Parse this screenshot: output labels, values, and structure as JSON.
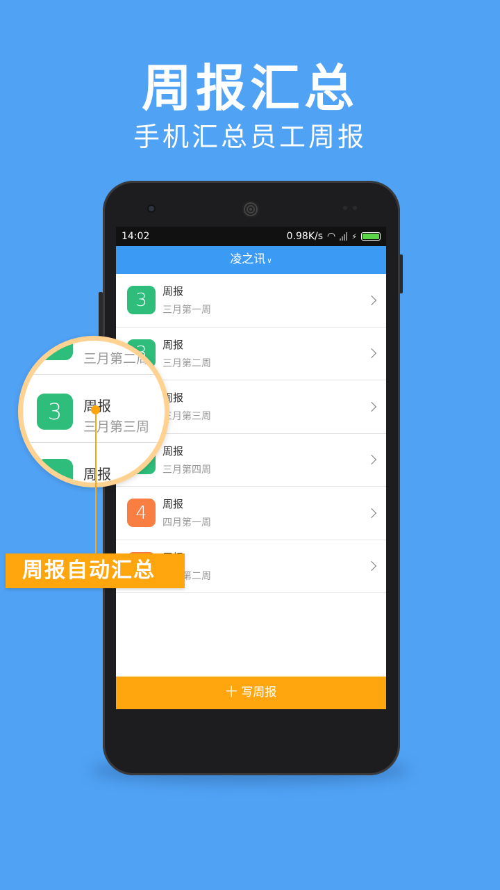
{
  "hero": {
    "title": "周报汇总",
    "subtitle": "手机汇总员工周报"
  },
  "status_bar": {
    "time": "14:02",
    "speed": "0.98K/s"
  },
  "app_bar": {
    "title": "凌之讯"
  },
  "reports": [
    {
      "badge": "3",
      "title": "周报",
      "subtitle": "三月第一周",
      "color": "#2ebd7a"
    },
    {
      "badge": "3",
      "title": "周报",
      "subtitle": "三月第二周",
      "color": "#2ebd7a"
    },
    {
      "badge": "3",
      "title": "周报",
      "subtitle": "三月第三周",
      "color": "#2ebd7a"
    },
    {
      "badge": "3",
      "title": "周报",
      "subtitle": "三月第四周",
      "color": "#2ebd7a"
    },
    {
      "badge": "4",
      "title": "周报",
      "subtitle": "四月第一周",
      "color": "#f87e42"
    },
    {
      "badge": "4",
      "title": "周报",
      "subtitle": "四月第二周",
      "color": "#f87e42"
    }
  ],
  "write_button": {
    "label": "十 写周报"
  },
  "magnifier": {
    "top_sub": "三月第二周",
    "mid_badge": "3",
    "mid_title": "周报",
    "mid_sub": "三月第三周",
    "bottom_title": "周报"
  },
  "callout": {
    "label": "周报自动汇总"
  },
  "colors": {
    "background": "#50a2f5",
    "app_bar": "#3b9af4",
    "accent": "#ffa60f",
    "green": "#2ebd7a",
    "orange": "#f87e42"
  }
}
